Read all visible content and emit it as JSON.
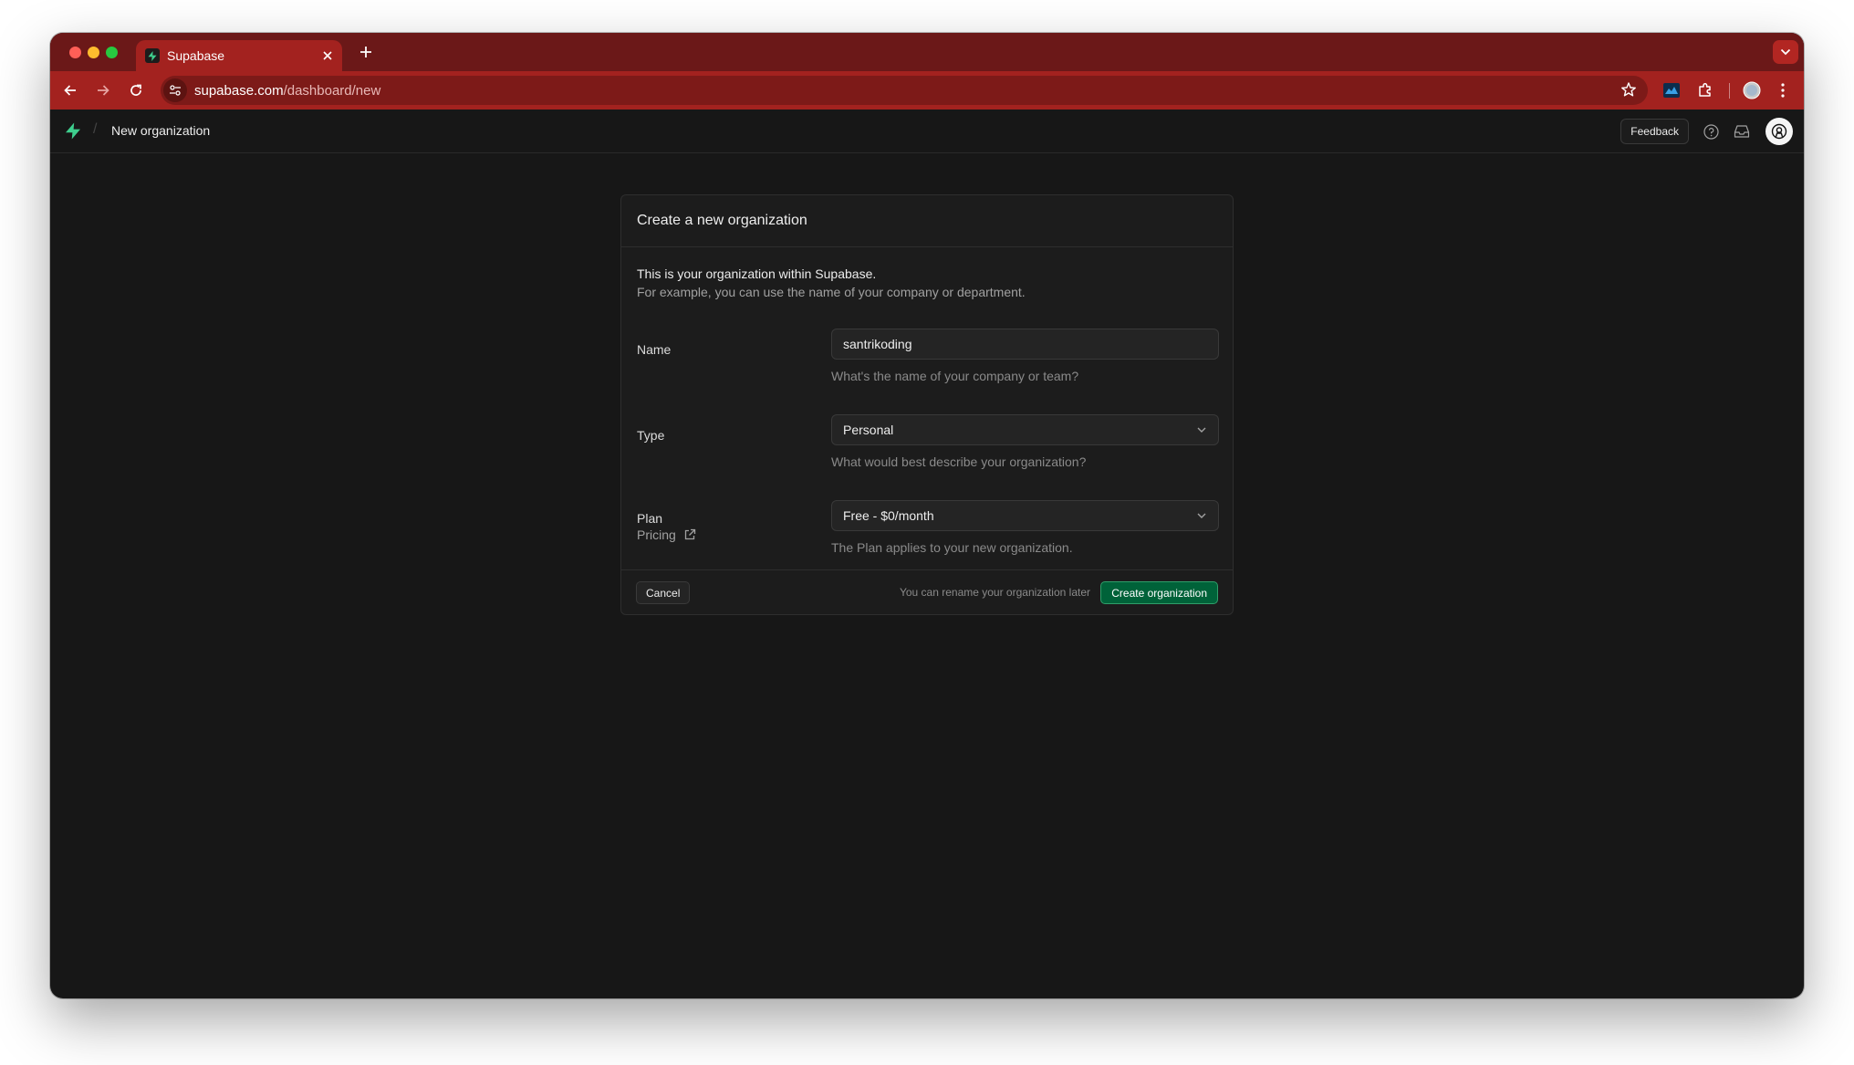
{
  "browser": {
    "tab_title": "Supabase",
    "url_host": "supabase.com",
    "url_path": "/dashboard/new",
    "icons": {
      "close": "close-icon",
      "new_tab": "plus-icon",
      "back": "back-arrow-icon",
      "forward": "forward-arrow-icon",
      "reload": "reload-icon",
      "site_info": "site-info-icon",
      "bookmark": "star-icon",
      "extension_1": "extension-chart-icon",
      "extensions": "puzzle-icon",
      "profile": "profile-icon",
      "menu": "kebab-menu-icon"
    },
    "colors": {
      "tabstrip": "#6b1818",
      "toolbar": "#a3221f"
    }
  },
  "app": {
    "breadcrumb_sep": "/",
    "breadcrumb": "New organization",
    "feedback_label": "Feedback",
    "brand_color": "#3ecf8e",
    "icons": {
      "logo": "supabase-logo-icon",
      "help": "help-circle-icon",
      "inbox": "inbox-icon",
      "avatar": "user-avatar-icon"
    }
  },
  "form": {
    "title": "Create a new organization",
    "intro_line1": "This is your organization within Supabase.",
    "intro_line2": "For example, you can use the name of your company or department.",
    "name": {
      "label": "Name",
      "value": "santrikoding",
      "help": "What's the name of your company or team?"
    },
    "type": {
      "label": "Type",
      "value": "Personal",
      "help": "What would best describe your organization?"
    },
    "plan": {
      "label": "Plan",
      "pricing_link": "Pricing",
      "value": "Free - $0/month",
      "help": "The Plan applies to your new organization."
    },
    "footer": {
      "cancel_label": "Cancel",
      "note": "You can rename your organization later",
      "create_label": "Create organization"
    },
    "primary_color": "#006239"
  }
}
